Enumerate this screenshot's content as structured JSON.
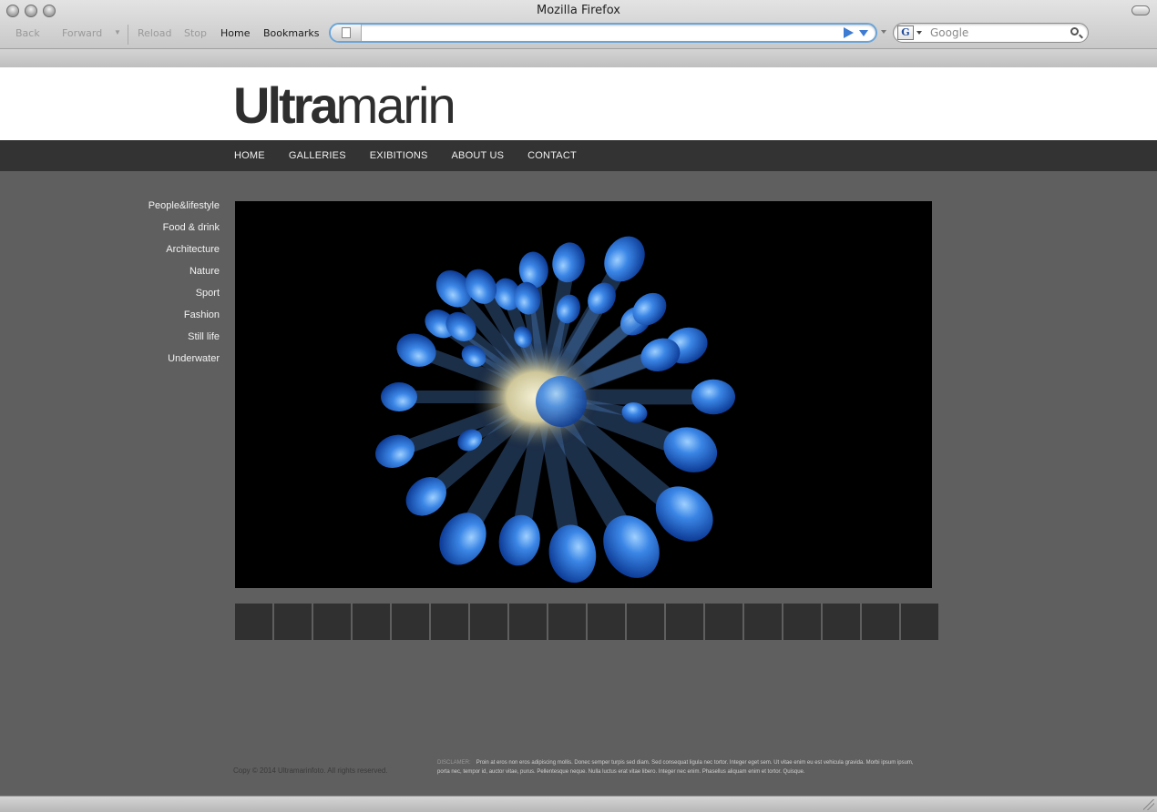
{
  "browser": {
    "window_title": "Mozilla Firefox",
    "toolbar": {
      "back_label": "Back",
      "forward_label": "Forward",
      "reload_label": "Reload",
      "stop_label": "Stop",
      "home_label": "Home",
      "bookmarks_label": "Bookmarks"
    },
    "url": {
      "value": ""
    },
    "search": {
      "placeholder": "Google",
      "engine_icon": "G"
    }
  },
  "site": {
    "logo": {
      "bold": "Ultra",
      "light": "marin"
    },
    "nav": [
      {
        "label": "HOME"
      },
      {
        "label": "GALLERIES"
      },
      {
        "label": "EXIBITIONS"
      },
      {
        "label": "ABOUT US"
      },
      {
        "label": "CONTACT"
      }
    ],
    "categories": [
      {
        "label": "People&lifestyle"
      },
      {
        "label": "Food & drink"
      },
      {
        "label": "Architecture"
      },
      {
        "label": "Nature"
      },
      {
        "label": "Sport"
      },
      {
        "label": "Fashion"
      },
      {
        "label": "Still life"
      },
      {
        "label": "Underwater"
      }
    ],
    "thumbnail_count": 18,
    "footer": {
      "copyright": "Copy © 2014 Ultramarinfoto. All rights reserved.",
      "disclaimer_label": "DISCLAMER:",
      "disclaimer_text": "Proin at eros non eros adipiscing mollis. Donec semper turpis sed diam. Sed consequat ligula nec tortor. Integer eget sem. Ut vitae enim eu est vehicula gravida. Morbi ipsum ipsum, porta nec, tempor id, auctor vitae, purus. Pellentesque neque. Nulla luctus erat vitae libero. Integer nec enim. Phasellus aliquam enim et tortor. Quisque."
    }
  },
  "colors": {
    "header_bg": "#ffffff",
    "nav_bg": "#333333",
    "content_bg": "#5f5f5f",
    "thumb_bg": "#303030",
    "hero_accent": "#2f6fd6"
  }
}
